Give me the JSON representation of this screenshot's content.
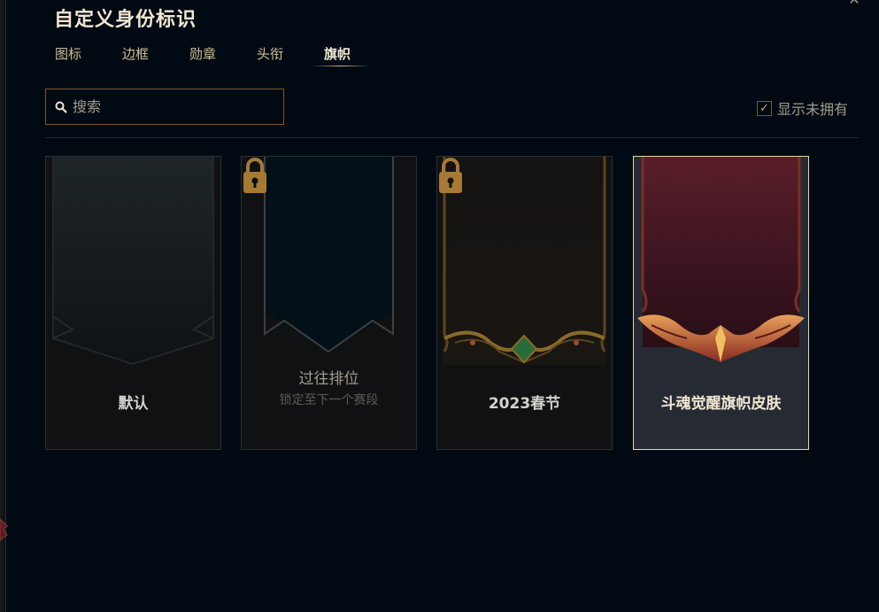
{
  "title": "自定义身份标识",
  "tabs": [
    {
      "label": "图标",
      "active": false
    },
    {
      "label": "边框",
      "active": false
    },
    {
      "label": "勋章",
      "active": false
    },
    {
      "label": "头衔",
      "active": false
    },
    {
      "label": "旗帜",
      "active": true
    }
  ],
  "search": {
    "placeholder": "搜索",
    "value": ""
  },
  "owned_toggle": {
    "label": "显示未拥有",
    "checked": true
  },
  "cards": [
    {
      "label": "默认",
      "sublabel": "",
      "locked": false,
      "selected": false
    },
    {
      "label": "过往排位",
      "sublabel": "锁定至下一个赛段",
      "locked": true,
      "selected": false
    },
    {
      "label": "2023春节",
      "sublabel": "",
      "locked": true,
      "selected": false
    },
    {
      "label": "斗魂觉醒旗帜皮肤",
      "sublabel": "",
      "locked": false,
      "selected": true
    }
  ],
  "icons": {
    "close": "close-icon",
    "search": "search-icon",
    "check": "checkmark-icon",
    "lock": "lock-icon"
  },
  "colors": {
    "background": "#010a13",
    "gold": "#c8aa6e",
    "gold_border": "#785a28",
    "selected_border": "#e6d7a5"
  }
}
